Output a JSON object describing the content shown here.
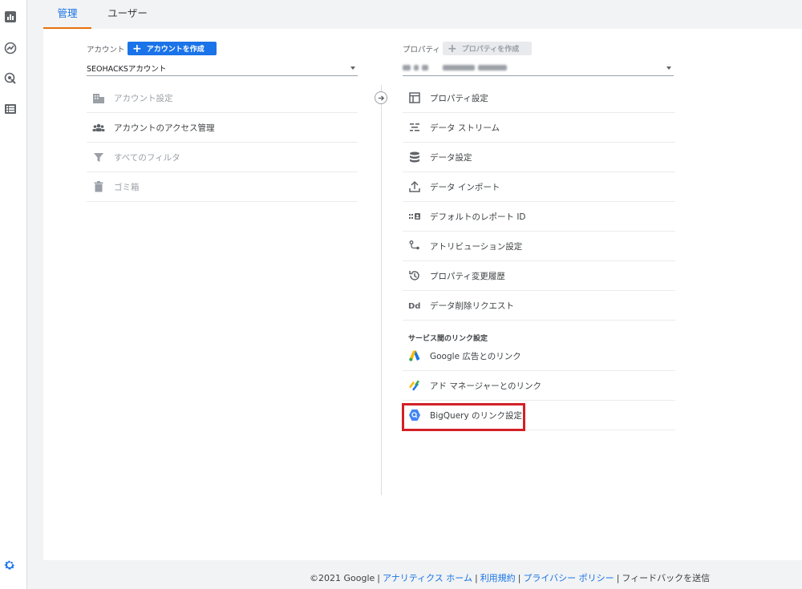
{
  "tabs": [
    {
      "label": "管理",
      "active": true
    },
    {
      "label": "ユーザー",
      "active": false
    }
  ],
  "leftnav": {
    "icons": [
      "reports-icon",
      "explore-icon",
      "advertising-icon",
      "configure-icon"
    ],
    "settings_icon": "gear-icon"
  },
  "account": {
    "label": "アカウント",
    "create_button": "アカウントを作成",
    "selected": "SEOHACKSアカウント",
    "items": [
      {
        "label": "アカウント設定",
        "icon": "building-icon",
        "disabled": true
      },
      {
        "label": "アカウントのアクセス管理",
        "icon": "people-icon",
        "disabled": false
      },
      {
        "label": "すべてのフィルタ",
        "icon": "filter-icon",
        "disabled": true
      },
      {
        "label": "ゴミ箱",
        "icon": "trash-icon",
        "disabled": true
      }
    ]
  },
  "property": {
    "label": "プロパティ",
    "create_button": "プロパティを作成",
    "selected": "",
    "items": [
      {
        "label": "プロパティ設定",
        "icon": "property-settings-icon"
      },
      {
        "label": "データ ストリーム",
        "icon": "data-stream-icon"
      },
      {
        "label": "データ設定",
        "icon": "database-icon"
      },
      {
        "label": "データ インポート",
        "icon": "upload-icon"
      },
      {
        "label": "デフォルトのレポート ID",
        "icon": "reporting-id-icon"
      },
      {
        "label": "アトリビューション設定",
        "icon": "attribution-icon"
      },
      {
        "label": "プロパティ変更履歴",
        "icon": "history-icon"
      },
      {
        "label": "データ削除リクエスト",
        "icon": "data-deletion-icon"
      }
    ],
    "links_section": "サービス間のリンク設定",
    "links": [
      {
        "label": "Google 広告とのリンク",
        "icon": "google-ads-icon"
      },
      {
        "label": "アド マネージャーとのリンク",
        "icon": "ad-manager-icon"
      },
      {
        "label": "BigQuery のリンク設定",
        "icon": "bigquery-icon"
      }
    ]
  },
  "colors": {
    "accent_blue": "#1a73e8",
    "tab_underline": "#e8710a",
    "highlight_red": "#d32027"
  },
  "footer": {
    "copyright": "©2021 Google",
    "links": [
      "アナリティクス ホーム",
      "利用規約",
      "プライバシー ポリシー"
    ],
    "feedback": "フィードバックを送信"
  }
}
